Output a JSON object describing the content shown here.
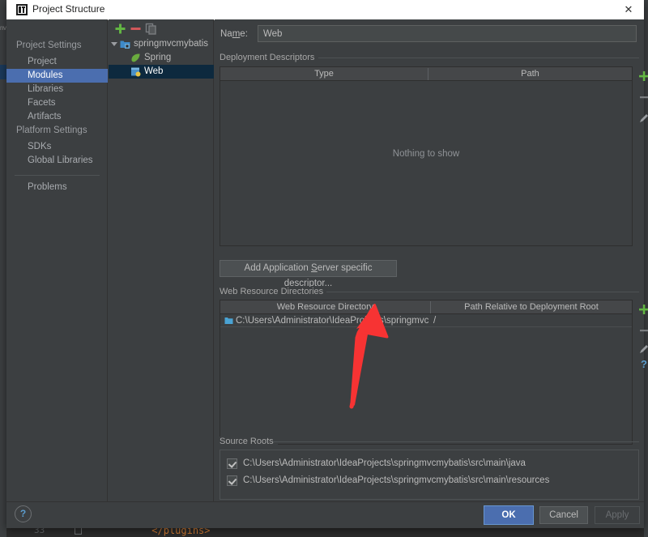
{
  "window": {
    "title": "Project Structure",
    "icon": "intellij-idea-icon",
    "close_label": "✕"
  },
  "nav": {
    "back_icon": "arrow-left-icon",
    "forward_icon": "arrow-right-icon"
  },
  "sidebar": {
    "groups": [
      {
        "label": "Project Settings",
        "items": [
          {
            "label": "Project",
            "selected": false
          },
          {
            "label": "Modules",
            "selected": true
          },
          {
            "label": "Libraries",
            "selected": false
          },
          {
            "label": "Facets",
            "selected": false
          },
          {
            "label": "Artifacts",
            "selected": false
          }
        ]
      },
      {
        "label": "Platform Settings",
        "items": [
          {
            "label": "SDKs",
            "selected": false
          },
          {
            "label": "Global Libraries",
            "selected": false
          }
        ]
      }
    ],
    "extra_items": [
      {
        "label": "Problems",
        "selected": false
      }
    ]
  },
  "module_tree": {
    "toolbar": [
      {
        "name": "add-module-button",
        "glyph": "+",
        "color": "#62b543"
      },
      {
        "name": "remove-module-button",
        "glyph": "–",
        "color": "#d9534f"
      },
      {
        "name": "copy-module-button",
        "glyph": "copy-icon",
        "color": "#7a7d80"
      }
    ],
    "nodes": [
      {
        "label": "springmvcmybatis",
        "icon": "module-folder-icon",
        "depth": 0,
        "expanded": true,
        "selected": false
      },
      {
        "label": "Spring",
        "icon": "spring-leaf-icon",
        "depth": 1,
        "expanded": false,
        "selected": false
      },
      {
        "label": "Web",
        "icon": "web-facet-icon",
        "depth": 1,
        "expanded": false,
        "selected": true
      }
    ]
  },
  "main": {
    "name_field": {
      "label": "Name:",
      "label_mnemonic": "m",
      "value": "Web"
    },
    "deployment_descriptors": {
      "group_label": "Deployment Descriptors",
      "columns": [
        "Type",
        "Path"
      ],
      "rows": [],
      "empty_message": "Nothing to show",
      "side_buttons": [
        {
          "name": "add-descriptor-button",
          "glyph": "+",
          "color": "#62b543"
        },
        {
          "name": "remove-descriptor-button",
          "glyph": "–",
          "color": "#7a7d80"
        },
        {
          "name": "edit-descriptor-button",
          "glyph": "pencil-icon",
          "color": "#9a9da1"
        }
      ]
    },
    "add_descriptor_button": {
      "label": "Add Application Server specific descriptor...",
      "mnemonic": "S"
    },
    "web_resource_directories": {
      "group_label": "Web Resource Directories",
      "columns": [
        "Web Resource Directory",
        "Path Relative to Deployment Root"
      ],
      "rows": [
        {
          "directory": "C:\\Users\\Administrator\\IdeaProjects\\springmvcmy...",
          "relative_path": "/",
          "icon": "folder-icon"
        }
      ],
      "side_buttons": [
        {
          "name": "add-web-resource-button",
          "glyph": "+",
          "color": "#62b543"
        },
        {
          "name": "remove-web-resource-button",
          "glyph": "–",
          "color": "#7a7d80"
        },
        {
          "name": "edit-web-resource-button",
          "glyph": "pencil-icon",
          "color": "#9a9da1"
        },
        {
          "name": "help-web-resource-button",
          "glyph": "?",
          "color": "#5c9ccc"
        }
      ]
    },
    "source_roots": {
      "group_label": "Source Roots",
      "items": [
        {
          "label": "C:\\Users\\Administrator\\IdeaProjects\\springmvcmybatis\\src\\main\\java",
          "checked": true
        },
        {
          "label": "C:\\Users\\Administrator\\IdeaProjects\\springmvcmybatis\\src\\main\\resources",
          "checked": true
        }
      ]
    }
  },
  "footer": {
    "help_label": "?",
    "buttons": [
      {
        "label": "OK",
        "style": "primary"
      },
      {
        "label": "Cancel",
        "style": "normal"
      },
      {
        "label": "Apply",
        "style": "disabled"
      }
    ]
  },
  "annotation": {
    "arrow_color": "#f73333",
    "name": "red-pointer-arrow"
  },
  "background": {
    "editor_line_text": "          </plugins>",
    "gutter_line_number": "33"
  },
  "colors": {
    "dialog_bg": "#3c3f41",
    "selection_blue": "#4b6eaf",
    "tree_selection": "#0d293e",
    "accent_green": "#62b543",
    "link_blue": "#5c9ccc"
  }
}
